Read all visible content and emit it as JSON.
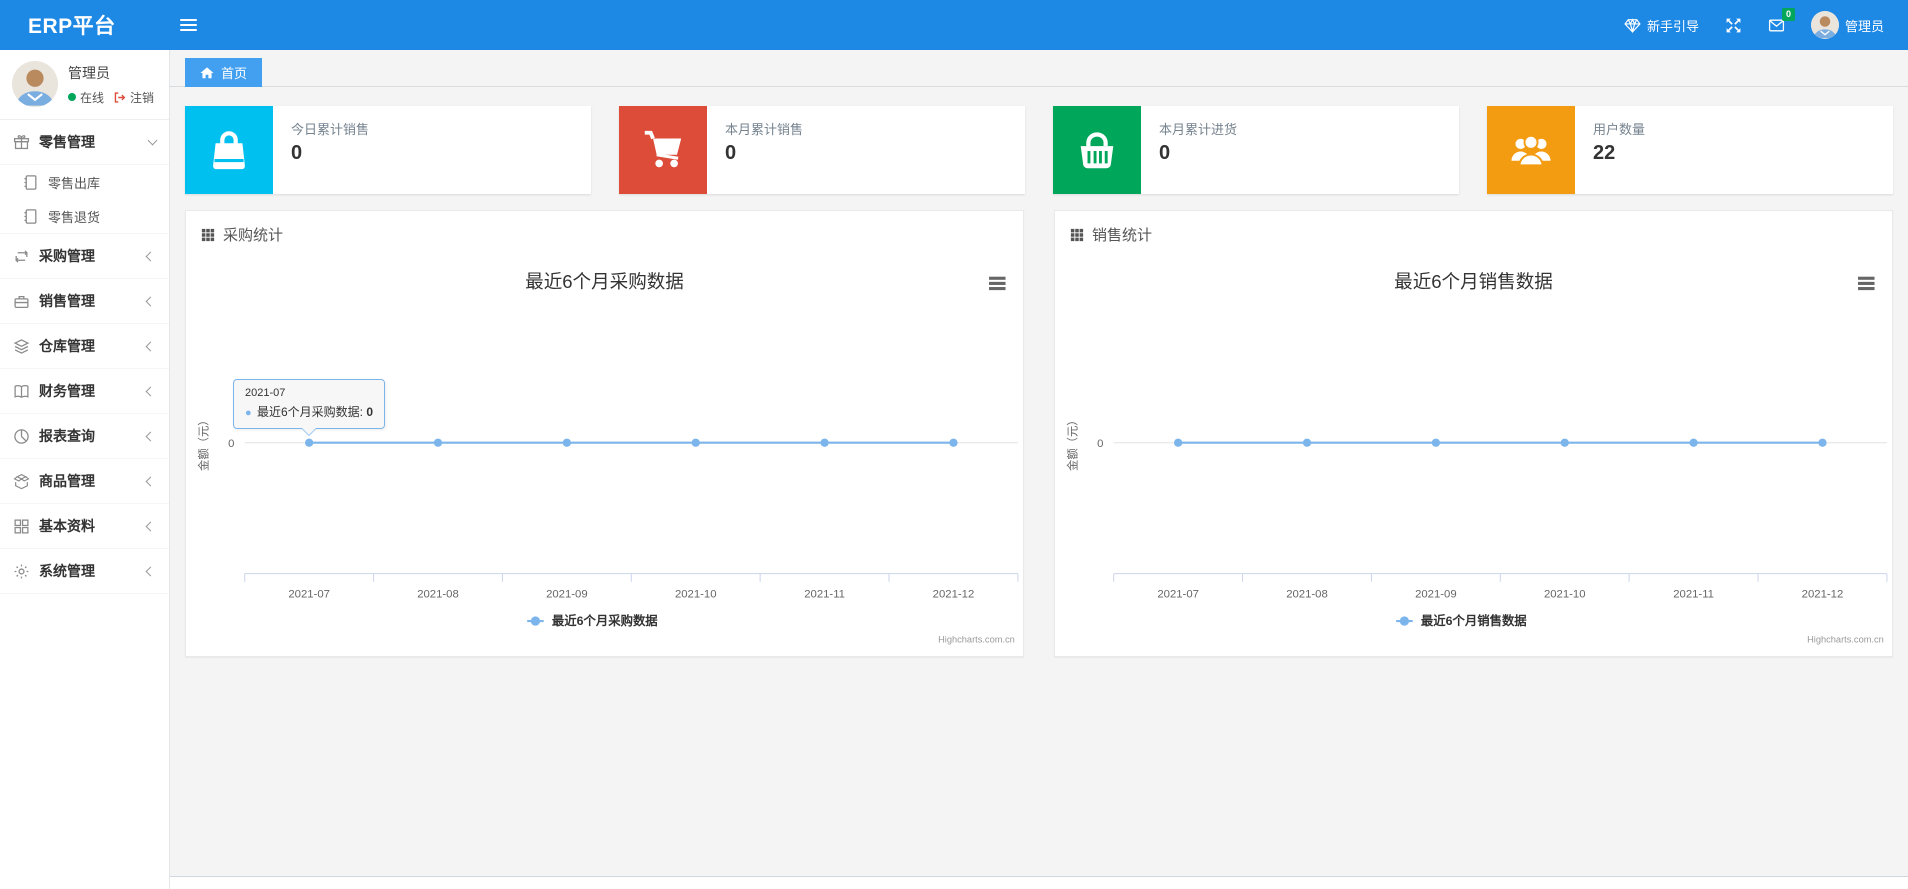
{
  "navbar": {
    "brand": "ERP平台",
    "guide_label": "新手引导",
    "message_badge": "0",
    "user_name": "管理员"
  },
  "sidebar": {
    "user": {
      "name": "管理员",
      "status": "在线",
      "logout_label": "注销"
    },
    "menu": [
      {
        "label": "零售管理",
        "icon": "gift-icon",
        "expanded": true,
        "children": [
          {
            "label": "零售出库",
            "icon": "notebook-icon"
          },
          {
            "label": "零售退货",
            "icon": "notebook-icon"
          }
        ]
      },
      {
        "label": "采购管理",
        "icon": "repeat-icon"
      },
      {
        "label": "销售管理",
        "icon": "briefcase-icon"
      },
      {
        "label": "仓库管理",
        "icon": "layers-icon"
      },
      {
        "label": "财务管理",
        "icon": "ledger-icon"
      },
      {
        "label": "报表查询",
        "icon": "pie-chart-icon"
      },
      {
        "label": "商品管理",
        "icon": "package-icon"
      },
      {
        "label": "基本资料",
        "icon": "grid-icon"
      },
      {
        "label": "系统管理",
        "icon": "gear-icon"
      }
    ]
  },
  "tabs": [
    {
      "label": "首页",
      "icon": "home-icon",
      "active": true
    }
  ],
  "stat_cards": [
    {
      "label": "今日累计销售",
      "value": "0",
      "color": "#00c0ef",
      "icon": "shopping-bag-icon"
    },
    {
      "label": "本月累计销售",
      "value": "0",
      "color": "#dd4b39",
      "icon": "cart-icon"
    },
    {
      "label": "本月累计进货",
      "value": "0",
      "color": "#00a65a",
      "icon": "basket-icon"
    },
    {
      "label": "用户数量",
      "value": "22",
      "color": "#f39c12",
      "icon": "users-icon"
    }
  ],
  "panels": [
    {
      "title": "采购统计"
    },
    {
      "title": "销售统计"
    }
  ],
  "chart_data": [
    {
      "type": "line",
      "title": "最近6个月采购数据",
      "categories": [
        "2021-07",
        "2021-08",
        "2021-09",
        "2021-10",
        "2021-11",
        "2021-12"
      ],
      "series": [
        {
          "name": "最近6个月采购数据",
          "values": [
            0,
            0,
            0,
            0,
            0,
            0
          ]
        }
      ],
      "xlabel": "",
      "ylabel": "金额（元）",
      "yticks": [
        "0"
      ],
      "grid": true,
      "legend_position": "bottom",
      "line_color": "#7cb5ec",
      "credits": "Highcharts.com.cn",
      "tooltip": {
        "category": "2021-07",
        "series": "最近6个月采购数据",
        "value": "0"
      }
    },
    {
      "type": "line",
      "title": "最近6个月销售数据",
      "categories": [
        "2021-07",
        "2021-08",
        "2021-09",
        "2021-10",
        "2021-11",
        "2021-12"
      ],
      "series": [
        {
          "name": "最近6个月销售数据",
          "values": [
            0,
            0,
            0,
            0,
            0,
            0
          ]
        }
      ],
      "xlabel": "",
      "ylabel": "金额（元）",
      "yticks": [
        "0"
      ],
      "grid": true,
      "legend_position": "bottom",
      "line_color": "#7cb5ec",
      "credits": "Highcharts.com.cn",
      "tooltip": null
    }
  ],
  "colors": {
    "navbar_bg": "#1e88e5",
    "active_tab_bg": "#43a0f0",
    "badge_bg": "#00a65a",
    "online_dot": "#00a65a",
    "logout_icon": "#dd4b39",
    "series_line": "#7cb5ec"
  }
}
